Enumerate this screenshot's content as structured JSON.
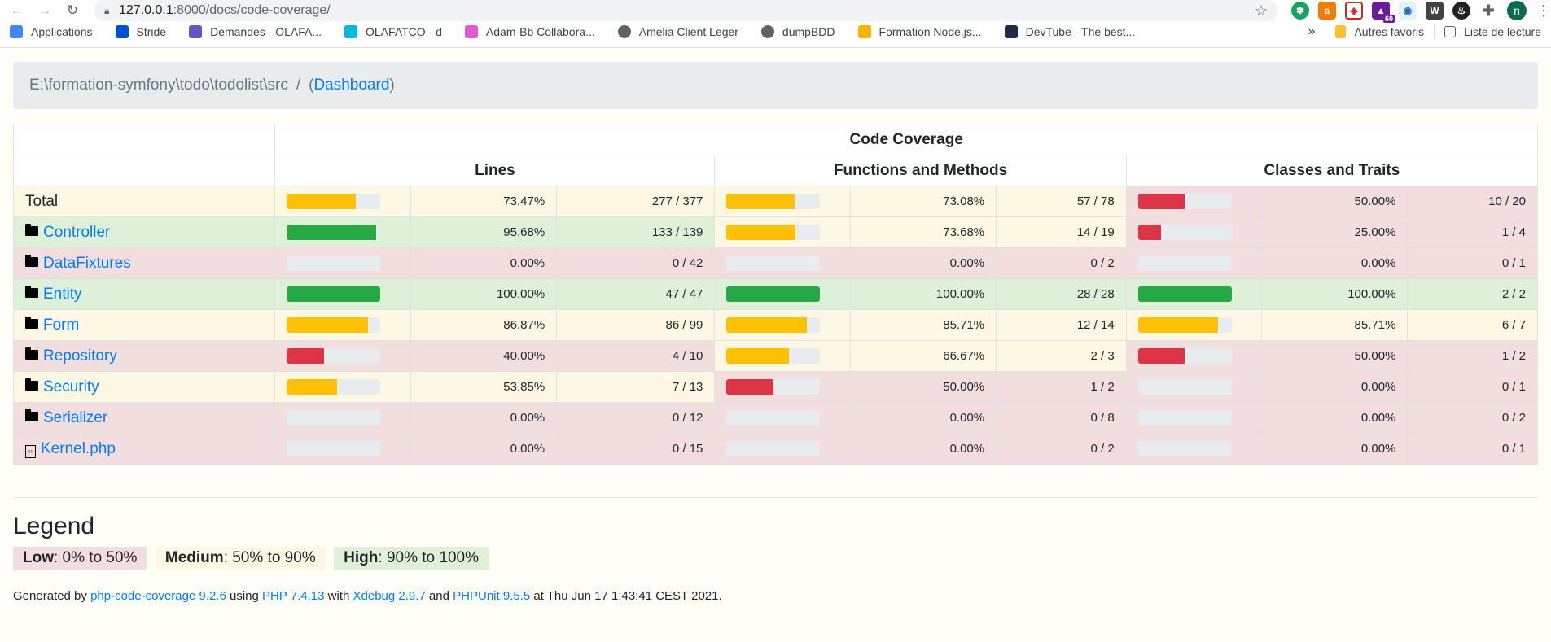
{
  "browser": {
    "url_host": "127.0.0.1",
    "url_rest": ":8000/docs/code-coverage/",
    "extension_badge": "60",
    "avatar_letter": "n",
    "bookmarks": [
      {
        "label": "Applications",
        "icon": "apps-grid-icon",
        "color": "#4285f4"
      },
      {
        "label": "Stride",
        "icon": "stride-icon",
        "color": "#0052cc"
      },
      {
        "label": "Demandes - OLAFA...",
        "icon": "dots-arc-icon",
        "color": "#6554c0"
      },
      {
        "label": "OLAFATCO - d",
        "icon": "circle-logo-icon",
        "color": "#00b8d9"
      },
      {
        "label": "Adam-Bb Collabora...",
        "icon": "collab-icon",
        "color": "#e05bd2"
      },
      {
        "label": "Amelia Client Leger",
        "icon": "globe-icon",
        "color": "#5f6368"
      },
      {
        "label": "dumpBDD",
        "icon": "globe-icon",
        "color": "#5f6368"
      },
      {
        "label": "Formation Node.js...",
        "icon": "slides-icon",
        "color": "#f4b400"
      },
      {
        "label": "DevTube - The best...",
        "icon": "devtube-icon",
        "color": "#1f2a44"
      }
    ],
    "more": "»",
    "other_bookmarks": "Autres favoris",
    "reading_list": "Liste de lecture"
  },
  "breadcrumb": {
    "path": "E:\\formation-symfony\\todo\\todolist\\src",
    "separator": "/",
    "open_paren": "(",
    "link": "Dashboard",
    "close_paren": ")"
  },
  "table": {
    "title": "Code Coverage",
    "groups": [
      "Lines",
      "Functions and Methods",
      "Classes and Traits"
    ],
    "rows": [
      {
        "name": "Total",
        "type": "total",
        "lines": {
          "pct": "73.47%",
          "frac": "277 / 377",
          "v": 0.7347,
          "level": "med"
        },
        "funcs": {
          "pct": "73.08%",
          "frac": "57 / 78",
          "v": 0.7308,
          "level": "med"
        },
        "classes": {
          "pct": "50.00%",
          "frac": "10 / 20",
          "v": 0.5,
          "level": "low"
        }
      },
      {
        "name": "Controller",
        "type": "folder",
        "lines": {
          "pct": "95.68%",
          "frac": "133 / 139",
          "v": 0.9568,
          "level": "high"
        },
        "funcs": {
          "pct": "73.68%",
          "frac": "14 / 19",
          "v": 0.7368,
          "level": "med"
        },
        "classes": {
          "pct": "25.00%",
          "frac": "1 / 4",
          "v": 0.25,
          "level": "low"
        }
      },
      {
        "name": "DataFixtures",
        "type": "folder",
        "lines": {
          "pct": "0.00%",
          "frac": "0 / 42",
          "v": 0,
          "level": "low"
        },
        "funcs": {
          "pct": "0.00%",
          "frac": "0 / 2",
          "v": 0,
          "level": "low"
        },
        "classes": {
          "pct": "0.00%",
          "frac": "0 / 1",
          "v": 0,
          "level": "low"
        }
      },
      {
        "name": "Entity",
        "type": "folder",
        "lines": {
          "pct": "100.00%",
          "frac": "47 / 47",
          "v": 1,
          "level": "high"
        },
        "funcs": {
          "pct": "100.00%",
          "frac": "28 / 28",
          "v": 1,
          "level": "high"
        },
        "classes": {
          "pct": "100.00%",
          "frac": "2 / 2",
          "v": 1,
          "level": "high"
        }
      },
      {
        "name": "Form",
        "type": "folder",
        "lines": {
          "pct": "86.87%",
          "frac": "86 / 99",
          "v": 0.8687,
          "level": "med"
        },
        "funcs": {
          "pct": "85.71%",
          "frac": "12 / 14",
          "v": 0.8571,
          "level": "med"
        },
        "classes": {
          "pct": "85.71%",
          "frac": "6 / 7",
          "v": 0.8571,
          "level": "med"
        }
      },
      {
        "name": "Repository",
        "type": "folder",
        "lines": {
          "pct": "40.00%",
          "frac": "4 / 10",
          "v": 0.4,
          "level": "low"
        },
        "funcs": {
          "pct": "66.67%",
          "frac": "2 / 3",
          "v": 0.6667,
          "level": "med"
        },
        "classes": {
          "pct": "50.00%",
          "frac": "1 / 2",
          "v": 0.5,
          "level": "low"
        }
      },
      {
        "name": "Security",
        "type": "folder",
        "lines": {
          "pct": "53.85%",
          "frac": "7 / 13",
          "v": 0.5385,
          "level": "med"
        },
        "funcs": {
          "pct": "50.00%",
          "frac": "1 / 2",
          "v": 0.5,
          "level": "low"
        },
        "classes": {
          "pct": "0.00%",
          "frac": "0 / 1",
          "v": 0,
          "level": "low"
        }
      },
      {
        "name": "Serializer",
        "type": "folder",
        "lines": {
          "pct": "0.00%",
          "frac": "0 / 12",
          "v": 0,
          "level": "low"
        },
        "funcs": {
          "pct": "0.00%",
          "frac": "0 / 8",
          "v": 0,
          "level": "low"
        },
        "classes": {
          "pct": "0.00%",
          "frac": "0 / 2",
          "v": 0,
          "level": "low"
        }
      },
      {
        "name": "Kernel.php",
        "type": "file",
        "lines": {
          "pct": "0.00%",
          "frac": "0 / 15",
          "v": 0,
          "level": "low"
        },
        "funcs": {
          "pct": "0.00%",
          "frac": "0 / 2",
          "v": 0,
          "level": "low"
        },
        "classes": {
          "pct": "0.00%",
          "frac": "0 / 1",
          "v": 0,
          "level": "low"
        }
      }
    ]
  },
  "legend": {
    "title": "Legend",
    "low_label": "Low",
    "low_range": ": 0% to 50%",
    "medium_label": "Medium",
    "medium_range": ": 50% to 90%",
    "high_label": "High",
    "high_range": ": 90% to 100%"
  },
  "footer": {
    "t1": "Generated by ",
    "l1": "php-code-coverage 9.2.6",
    "t2": " using ",
    "l2": "PHP 7.4.13",
    "t3": " with ",
    "l3": "Xdebug 2.9.7",
    "t4": " and ",
    "l4": "PHPUnit 9.5.5",
    "t5": " at Thu Jun 17 1:43:41 CEST 2021."
  },
  "colors": {
    "low_bg": "#f2dede",
    "medium_bg": "#fcf8e3",
    "high_bg": "#dff0d8",
    "link": "#007bff"
  }
}
